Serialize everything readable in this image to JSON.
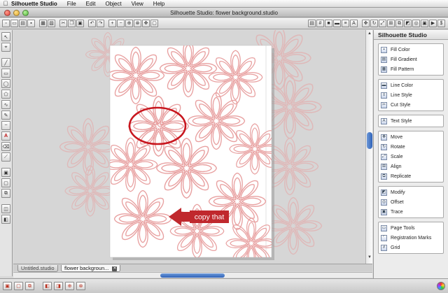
{
  "menubar": {
    "app_name": "Silhouette Studio",
    "items": [
      "File",
      "Edit",
      "Object",
      "View",
      "Help"
    ]
  },
  "window": {
    "title": "Silhouette Studio: flower background.studio"
  },
  "right_panel": {
    "title": "Silhouette Studio",
    "groups": [
      {
        "items": [
          {
            "label": "Fill Color",
            "icon": "fill-color-icon"
          },
          {
            "label": "Fill Gradient",
            "icon": "fill-gradient-icon"
          },
          {
            "label": "Fill Pattern",
            "icon": "fill-pattern-icon"
          }
        ]
      },
      {
        "items": [
          {
            "label": "Line Color",
            "icon": "line-color-icon"
          },
          {
            "label": "Line Style",
            "icon": "line-style-icon"
          },
          {
            "label": "Cut Style",
            "icon": "cut-style-icon"
          }
        ]
      },
      {
        "items": [
          {
            "label": "Text Style",
            "icon": "text-style-icon"
          }
        ]
      },
      {
        "items": [
          {
            "label": "Move",
            "icon": "move-icon"
          },
          {
            "label": "Rotate",
            "icon": "rotate-icon"
          },
          {
            "label": "Scale",
            "icon": "scale-icon"
          },
          {
            "label": "Align",
            "icon": "align-icon"
          },
          {
            "label": "Replicate",
            "icon": "replicate-icon"
          }
        ]
      },
      {
        "items": [
          {
            "label": "Modify",
            "icon": "modify-icon"
          },
          {
            "label": "Offset",
            "icon": "offset-icon"
          },
          {
            "label": "Trace",
            "icon": "trace-icon"
          }
        ]
      },
      {
        "items": [
          {
            "label": "Page Tools",
            "icon": "page-tools-icon"
          },
          {
            "label": "Registration Marks",
            "icon": "registration-marks-icon"
          },
          {
            "label": "Grid",
            "icon": "grid-icon"
          }
        ]
      }
    ]
  },
  "tabs": [
    {
      "label": "Untitled.studio",
      "active": false
    },
    {
      "label": "flower backgroun...",
      "active": true
    }
  ],
  "annotation": {
    "arrow_text": "copy that",
    "colors": {
      "arrow": "#c0282d",
      "circle": "#c8161e",
      "flower_stroke": "#e8a0a0"
    }
  },
  "colors": {
    "canvas_bg": "#d6d6d6",
    "page_bg": "#ffffff",
    "scroll_thumb": "#3a6fc4"
  }
}
